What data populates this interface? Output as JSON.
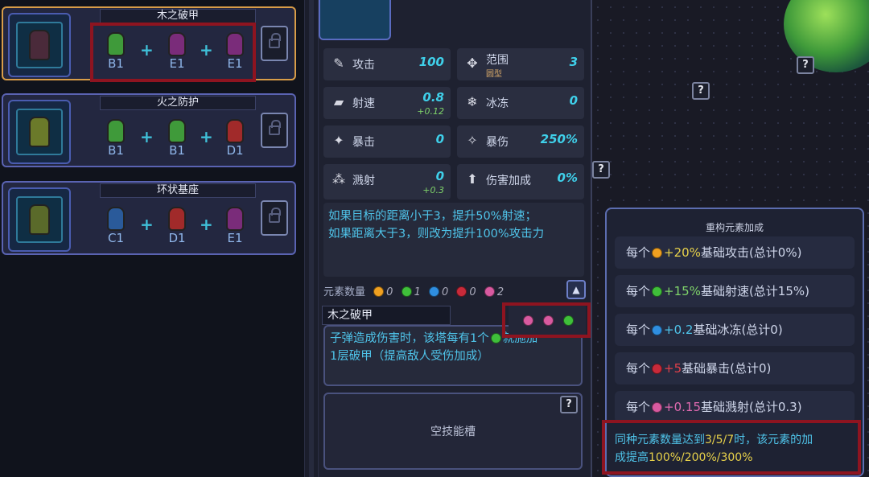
{
  "recipes": [
    {
      "title": "木之破甲",
      "slots": [
        {
          "label": "B1",
          "color": "#3f9a3a"
        },
        {
          "label": "E1",
          "color": "#7a2c7a"
        },
        {
          "label": "E1",
          "color": "#7a2c7a"
        }
      ],
      "tower_color": "#4a2a3a"
    },
    {
      "title": "火之防护",
      "slots": [
        {
          "label": "B1",
          "color": "#3f9a3a"
        },
        {
          "label": "B1",
          "color": "#3f9a3a"
        },
        {
          "label": "D1",
          "color": "#a12a2a"
        }
      ],
      "tower_color": "#6b7a2a"
    },
    {
      "title": "环状基座",
      "slots": [
        {
          "label": "C1",
          "color": "#2a5a9a"
        },
        {
          "label": "D1",
          "color": "#a12a2a"
        },
        {
          "label": "E1",
          "color": "#7a2c7a"
        }
      ],
      "tower_color": "#5a6a2a"
    }
  ],
  "stats": {
    "attack": {
      "name": "攻击",
      "value": "100",
      "icon": "sword-icon"
    },
    "range": {
      "name": "范围",
      "value": "3",
      "sub": "圆型",
      "icon": "range-icon"
    },
    "fire_rate": {
      "name": "射速",
      "value": "0.8",
      "bonus": "+0.12",
      "icon": "gun-icon"
    },
    "freeze": {
      "name": "冰冻",
      "value": "0",
      "icon": "freeze-icon"
    },
    "crit": {
      "name": "暴击",
      "value": "0",
      "icon": "crit-icon"
    },
    "crit_dmg": {
      "name": "暴伤",
      "value": "250%",
      "icon": "critdmg-icon"
    },
    "splash": {
      "name": "溅射",
      "value": "0",
      "bonus": "+0.3",
      "icon": "splash-icon"
    },
    "dmg_bonus": {
      "name": "伤害加成",
      "value": "0%",
      "icon": "arrow-up-icon"
    }
  },
  "description": [
    "如果目标的距离小于3，提升50%射速；",
    "如果距离大于3，则改为提升100%攻击力"
  ],
  "elements": {
    "label": "元素数量",
    "counts": [
      "0",
      "1",
      "0",
      "0",
      "2"
    ],
    "colors": [
      "#f0a020",
      "#3fbf3a",
      "#2f8ee0",
      "#c82a3a",
      "#d85aa0"
    ]
  },
  "skill": {
    "name": "木之破甲",
    "text_line1": "子弹造成伤害时，该塔每有1个",
    "text_line1_tail": "就施加",
    "text_line2": "1层破甲（提高敌人受伤加成）",
    "gem_colors": [
      "#d85aa0",
      "#d85aa0",
      "#3fbf3a"
    ]
  },
  "empty_slot": "空技能槽",
  "popup": {
    "title": "重构元素加成",
    "rows": [
      {
        "prefix": "每个",
        "amount": "+20%",
        "label": "基础攻击(总计0%)",
        "color": "#f0a020"
      },
      {
        "prefix": "每个",
        "amount": "+15%",
        "label": "基础射速(总计15%)",
        "color": "#3fbf3a"
      },
      {
        "prefix": "每个",
        "amount": "+0.2",
        "label": "基础冰冻(总计0)",
        "color": "#2f8ee0"
      },
      {
        "prefix": "每个",
        "amount": "+5",
        "label": "基础暴击(总计0)",
        "color": "#c82a3a"
      },
      {
        "prefix": "每个",
        "amount": "+0.15",
        "label": "基础溅射(总计0.3)",
        "color": "#d85aa0"
      }
    ],
    "note_a": "同种元素数量达到",
    "note_b": "3/5/7",
    "note_c": "时，该元素的加",
    "note_d": "成提高",
    "note_e": "100%/200%/300%"
  },
  "help_glyph": "?",
  "up_glyph": "▲"
}
